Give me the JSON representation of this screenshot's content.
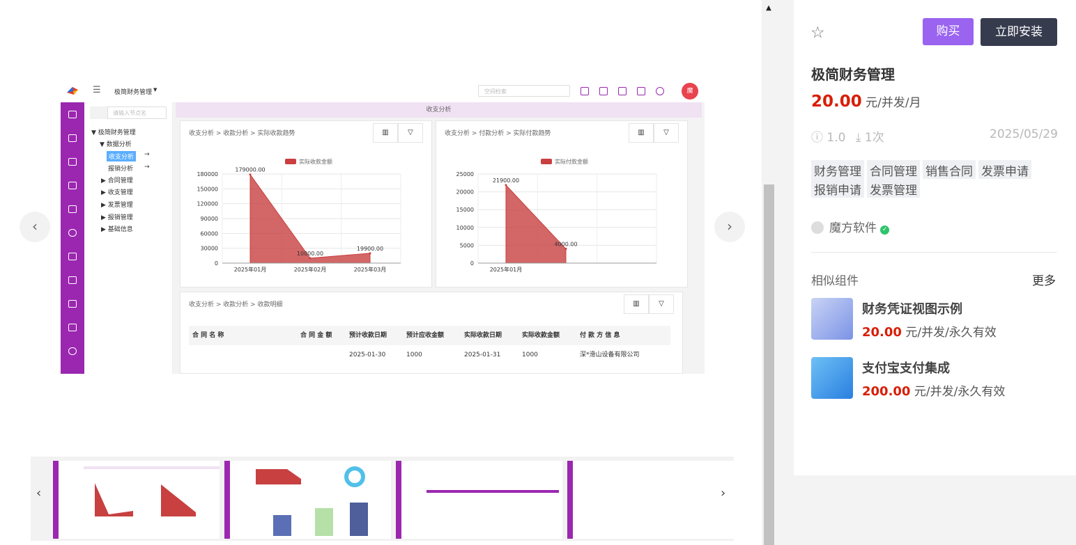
{
  "preview": {
    "app_name": "极简财务管理",
    "search_placeholder": "空间检索",
    "avatar_text": "魔",
    "tree_search_placeholder": "请输入节点名",
    "tree": [
      "极简财务管理",
      "数据分析",
      "收支分析",
      "报销分析",
      "合同管理",
      "收支管理",
      "发票管理",
      "报销管理",
      "基础信息"
    ],
    "main_title": "收支分析",
    "card1": {
      "crumb": "收支分析 > 收款分析 > 实际收款趋势",
      "legend": "实际收款金额",
      "chart_data": {
        "type": "area",
        "categories": [
          "2025年01月",
          "2025年02月",
          "2025年03月"
        ],
        "values": [
          179000,
          10000,
          19900
        ],
        "data_labels": [
          "179000.00",
          "10000.00",
          "19900.00"
        ],
        "yticks": [
          "180000",
          "150000",
          "120000",
          "90000",
          "60000",
          "30000",
          "0"
        ],
        "ylim": [
          0,
          180000
        ],
        "color": "#c84040"
      }
    },
    "card2": {
      "crumb": "收支分析 > 付款分析 > 实际付款趋势",
      "legend": "实际付款金额",
      "chart_data": {
        "type": "area",
        "categories": [
          "2025年01月"
        ],
        "values": [
          21900,
          4000
        ],
        "data_labels": [
          "21900.00",
          "4000.00"
        ],
        "yticks": [
          "25000",
          "20000",
          "15000",
          "10000",
          "5000",
          "0"
        ],
        "ylim": [
          0,
          25000
        ],
        "color": "#c84040"
      }
    },
    "card3": {
      "crumb": "收支分析 > 收款分析 > 收款明细",
      "headers": [
        "合 同 名 称",
        "合 同 金 额",
        "预计收款日期",
        "预计应收金额",
        "实际收款日期",
        "实际收款金额",
        "付 款 方 信 息"
      ],
      "row": [
        "",
        "",
        "2025-01-30",
        "1000",
        "2025-01-31",
        "1000",
        "深*滑山设备有限公司"
      ]
    }
  },
  "right": {
    "buy_label": "购买",
    "install_label": "立即安装",
    "title": "极简财务管理",
    "price": "20.00",
    "price_unit": "元/并发/月",
    "version": "1.0",
    "downloads": "1次",
    "date": "2025/05/29",
    "tags": [
      "财务管理",
      "合同管理",
      "销售合同",
      "发票申请",
      "报销申请",
      "发票管理"
    ],
    "vendor": "魔方软件",
    "similar_title": "相似组件",
    "more_label": "更多",
    "similar": [
      {
        "name": "财务凭证视图示例",
        "price": "20.00",
        "unit": "元/并发/永久有效"
      },
      {
        "name": "支付宝支付集成",
        "price": "200.00",
        "unit": "元/并发/永久有效"
      }
    ]
  },
  "colors": {
    "accent": "#9a63f0",
    "dark_button": "#363b4e",
    "price_red": "#d81e06",
    "sidebar_purple": "#9b27b0"
  }
}
